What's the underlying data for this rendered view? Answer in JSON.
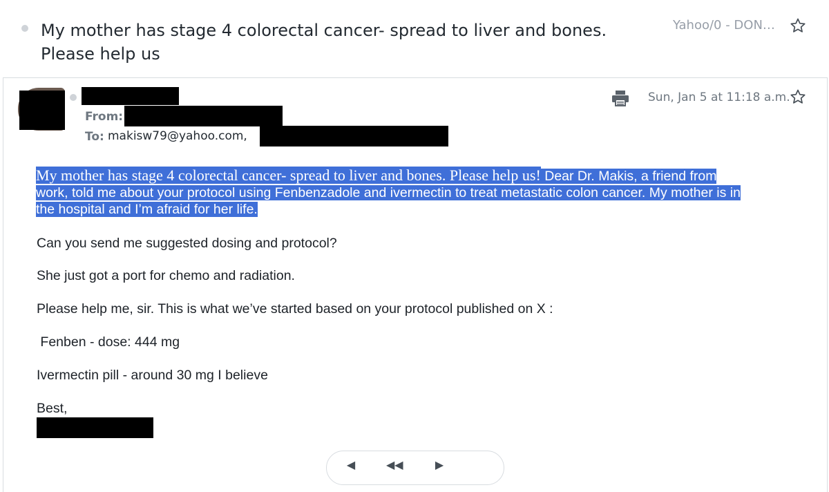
{
  "subject": {
    "title": "My mother has stage 4 colorectal cancer- spread to liver and bones. Please help us",
    "folder": "Yahoo/0 - DON…"
  },
  "message": {
    "from_label": "From:",
    "to_label": "To:",
    "to_value": "makisw79@yahoo.com,",
    "date": "Sun, Jan 5 at 11:18 a.m."
  },
  "body": {
    "highlight_line1_serif": "My mother has stage 4 colorectal cancer- spread to liver and bones. Please help us!",
    "highlight_line1_rest": " Dear Dr. Makis, a friend from",
    "highlight_line2": "work, told me about your protocol using Fenbenzadole and ivermectin to treat metastatic colon cancer. My mother is in",
    "highlight_line3": "the hospital and I’m afraid for her life.",
    "p1": "Can you send me suggested dosing and protocol?",
    "p2": "She just got a port for chemo and radiation.",
    "p3": "Please help me, sir. This is what we’ve started based on your protocol published on X :",
    "p4": " Fenben - dose: 444 mg",
    "p5": "Ivermectin pill - around 30 mg I believe",
    "p6": "Best,"
  },
  "icons": {
    "star": "star-outline-icon",
    "print": "printer-icon",
    "toolbar": [
      "back-icon",
      "reply-all-icon",
      "forward-icon"
    ]
  }
}
